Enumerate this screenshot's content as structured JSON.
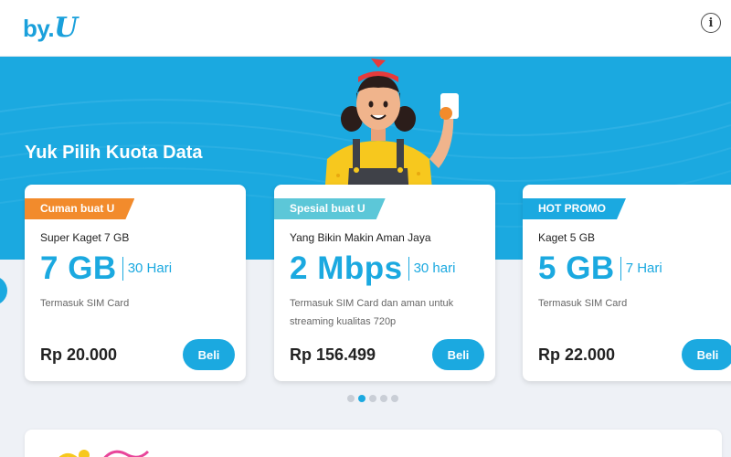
{
  "header": {
    "logo_text": "by.",
    "logo_u": "U",
    "info_icon": "info-icon"
  },
  "hero": {
    "title": "Yuk Pilih Kuota Data",
    "background_color": "#1ba9e0"
  },
  "cards": [
    {
      "tag": "Cuman buat U",
      "tag_color": "#f28b2c",
      "name": "Super Kaget 7 GB",
      "quota": "7 GB",
      "period": "30 Hari",
      "desc": "Termasuk SIM Card",
      "price": "Rp 20.000",
      "button": "Beli"
    },
    {
      "tag": "Spesial buat U",
      "tag_color": "#5cc7d8",
      "name": "Yang Bikin Makin Aman Jaya",
      "quota": "2 Mbps",
      "period": "30 hari",
      "desc": "Termasuk SIM Card dan aman untuk streaming kualitas 720p",
      "price": "Rp 156.499",
      "button": "Beli"
    },
    {
      "tag": "HOT PROMO",
      "tag_color": "#1ba9e0",
      "name": "Kaget 5 GB",
      "quota": "5 GB",
      "period": "7 Hari",
      "desc": "Termasuk SIM Card",
      "price": "Rp 22.000",
      "button": "Beli"
    }
  ],
  "carousel": {
    "total_dots": 5,
    "active_index": 1,
    "prev_icon": "chevron-left-icon"
  },
  "colors": {
    "accent": "#1ba9e0",
    "orange": "#f28b2c",
    "teal": "#5cc7d8"
  }
}
